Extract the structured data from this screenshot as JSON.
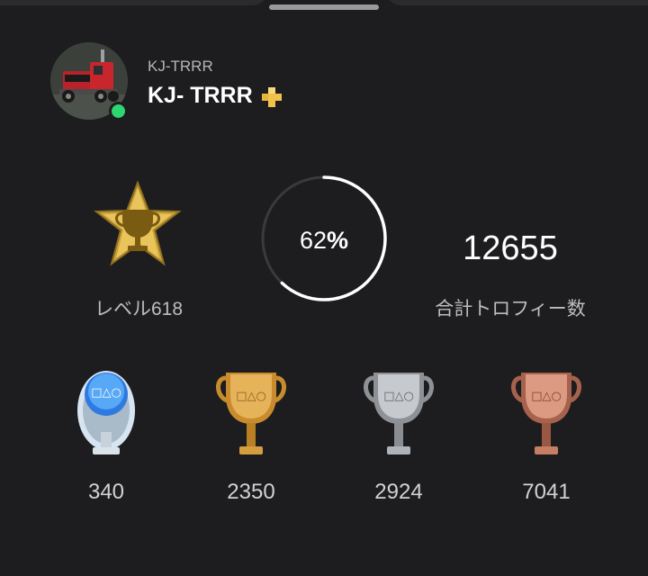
{
  "profile": {
    "online_id": "KJ-TRRR",
    "name": "KJ- TRRR",
    "plus_icon": "ps-plus-icon",
    "online_status_color": "#2ed573"
  },
  "stats": {
    "level_label": "レベル618",
    "level_icon": "gold-star-trophy-icon",
    "progress_value": "62",
    "progress_unit": "%",
    "progress_fraction": 0.62,
    "total_trophies": "12655",
    "total_label": "合計トロフィー数"
  },
  "trophies": [
    {
      "type": "platinum",
      "icon": "platinum-trophy-icon",
      "count": "340"
    },
    {
      "type": "gold",
      "icon": "gold-trophy-icon",
      "count": "2350"
    },
    {
      "type": "silver",
      "icon": "silver-trophy-icon",
      "count": "2924"
    },
    {
      "type": "bronze",
      "icon": "bronze-trophy-icon",
      "count": "7041"
    }
  ],
  "colors": {
    "background": "#1d1d1f",
    "accent_gold": "#f0c24a",
    "platinum": "#4f9fef",
    "silver": "#b8bcc0",
    "bronze": "#d38f76"
  }
}
